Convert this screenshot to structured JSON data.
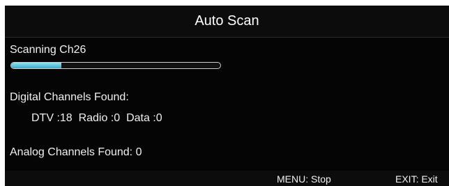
{
  "dialog": {
    "title": "Auto Scan"
  },
  "scan": {
    "status": "Scanning Ch26",
    "progress_fraction": 0.24
  },
  "digital": {
    "heading": "Digital Channels Found:",
    "counts_text": "DTV :18  Radio :0  Data :0"
  },
  "analog": {
    "found_text": "Analog Channels Found: 0"
  },
  "footer": {
    "menu_hint": "MENU: Stop",
    "exit_hint": "EXIT: Exit"
  },
  "colors": {
    "background": "#050505",
    "progress_fill": "#5cc6e0",
    "text": "#f0f0f0"
  }
}
